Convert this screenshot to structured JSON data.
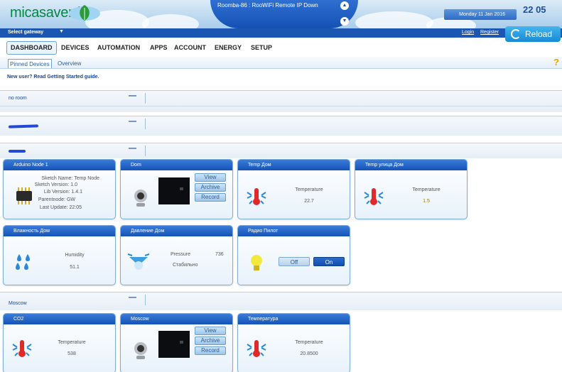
{
  "header": {
    "logo_text": "micasaverde",
    "alert_text": "Roomba-86 : RooWiFi Remote IP Down",
    "date": "Monday 11 Jan 2016",
    "time": "22 05"
  },
  "gateway_bar": {
    "select_label": "Select gateway",
    "login_label": "Login",
    "register_label": "Register",
    "reload_label": "Reload"
  },
  "tabs": [
    "DASHBOARD",
    "DEVICES",
    "AUTOMATION",
    "APPS",
    "ACCOUNT",
    "ENERGY",
    "SETUP"
  ],
  "subtabs": [
    "Pinned Devices",
    "Overview"
  ],
  "getting_started": "New user? Read Getting Started guide.",
  "rooms": [
    "no room",
    "",
    "",
    "Moscow"
  ],
  "cards": {
    "arduino": {
      "title": "Arduino Node 1",
      "lines": [
        "Sketch Name: Temp Node",
        "Sketch Version: 1.0",
        "Lib Version: 1.4.1",
        "Parentnode: GW",
        "Last Update: 22:05"
      ]
    },
    "dom": {
      "title": "Dom",
      "buttons": [
        "View",
        "Archive",
        "Record"
      ]
    },
    "temp_dom": {
      "title": "Temp Дом",
      "label": "Temperature",
      "value": "22.7"
    },
    "temp_street": {
      "title": "Temp улица Дом",
      "label": "Temperature",
      "value": "1.5"
    },
    "humidity": {
      "title": "Влажность Дом",
      "label": "Humidity",
      "value": "51.1"
    },
    "pressure": {
      "title": "Давление Дом",
      "label": "Pressure",
      "value": "736",
      "status": "Стабильно"
    },
    "radio": {
      "title": "Радио Пилот",
      "off": "Off",
      "on": "On"
    },
    "co2": {
      "title": "CO2",
      "label": "Temperature",
      "value": "538"
    },
    "moscow": {
      "title": "Moscow",
      "buttons": [
        "View",
        "Archive",
        "Record"
      ]
    },
    "temperatura": {
      "title": "Температура",
      "label": "Temperature",
      "value": "20.8500"
    }
  },
  "colors": {
    "header_blue": "#1c56b3",
    "card_header": "#1553b8",
    "logo_green": "#00893f",
    "help": "#f0a000",
    "on_button": "#1553b8"
  }
}
